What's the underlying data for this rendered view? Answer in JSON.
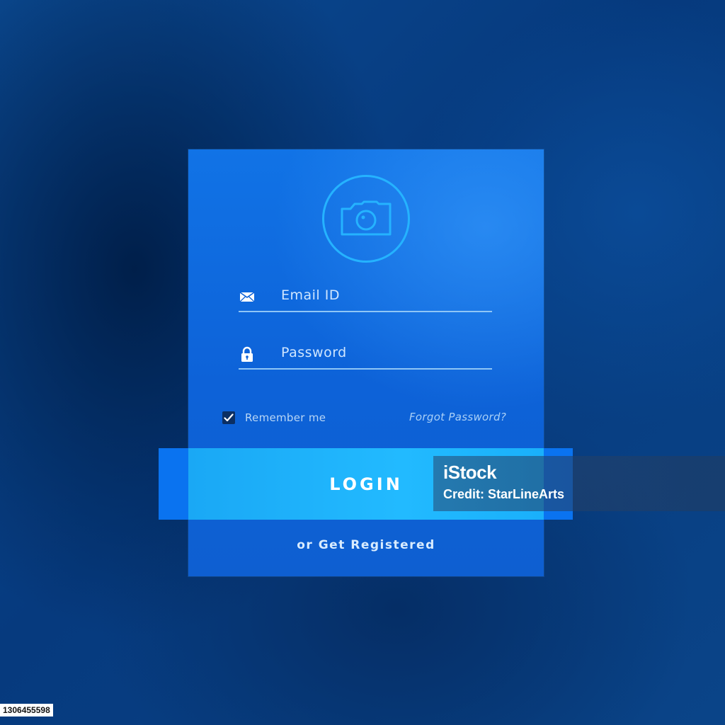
{
  "form": {
    "email_placeholder": "Email ID",
    "password_placeholder": "Password",
    "remember_label": "Remember me",
    "remember_checked": true,
    "forgot_label": "Forgot Password?",
    "login_label": "LOGIN",
    "register_label": "or Get Registered"
  },
  "icons": {
    "avatar": "camera-icon",
    "email": "envelope-icon",
    "password": "lock-icon",
    "checkbox": "check-icon"
  },
  "watermark": {
    "logo": "iStock",
    "credit": "Credit: StarLineArts"
  },
  "image_id": "1306455598",
  "colors": {
    "background": "#0b4a92",
    "card": "#0d62d8",
    "accent": "#25b3ff",
    "login_button": "#22baff"
  }
}
